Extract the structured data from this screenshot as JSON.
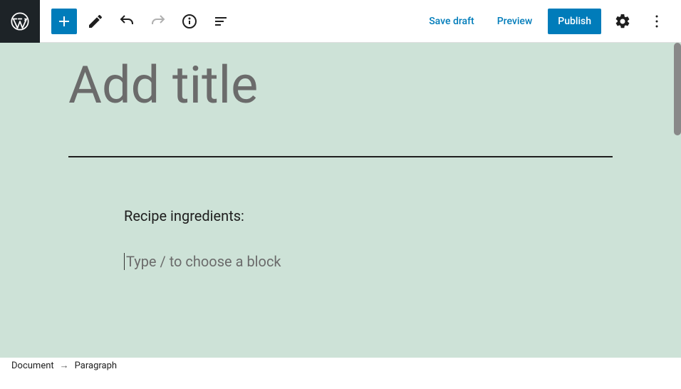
{
  "toolbar": {
    "save_draft": "Save draft",
    "preview": "Preview",
    "publish": "Publish"
  },
  "editor": {
    "title_placeholder": "Add title",
    "paragraph1": "Recipe ingredients:",
    "block_prompt": "Type / to choose a block"
  },
  "breadcrumb": {
    "root": "Document",
    "current": "Paragraph"
  }
}
